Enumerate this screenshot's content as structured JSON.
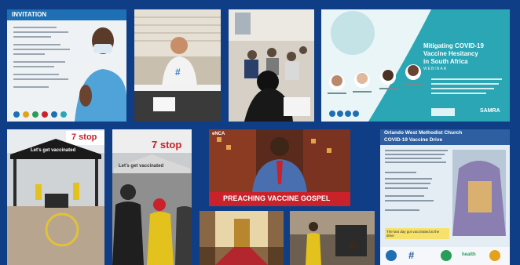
{
  "tiles": {
    "invitation": {
      "heading": "INVITATION",
      "icon": "syringe-icon"
    },
    "webinar": {
      "title_line1": "Mitigating COVID-19",
      "title_line2": "Vaccine Hesitancy",
      "title_line3": "in South Africa",
      "subtitle": "WEBINAR",
      "logo_right": "SAMRA"
    },
    "store_sign_left": "7 stop",
    "tent_banner": "Let's get vaccinated",
    "store_sign_right": "7 stop",
    "tent_banner_right": "Let's get vaccinated",
    "news": {
      "lower_third": "PREACHING VACCINE GOSPEL",
      "channel_bug": "eNCA"
    },
    "church": {
      "title_line1": "Orlando West Methodist Church",
      "title_line2": "COVID-19 Vaccine Drive",
      "bottom_text": "The last day got vaccinated at the drive",
      "hashtag": "#",
      "logo": "health"
    }
  },
  "colors": {
    "background": "#0f3e86",
    "accent_teal": "#2aa6b5",
    "news_red": "#c9222b"
  }
}
